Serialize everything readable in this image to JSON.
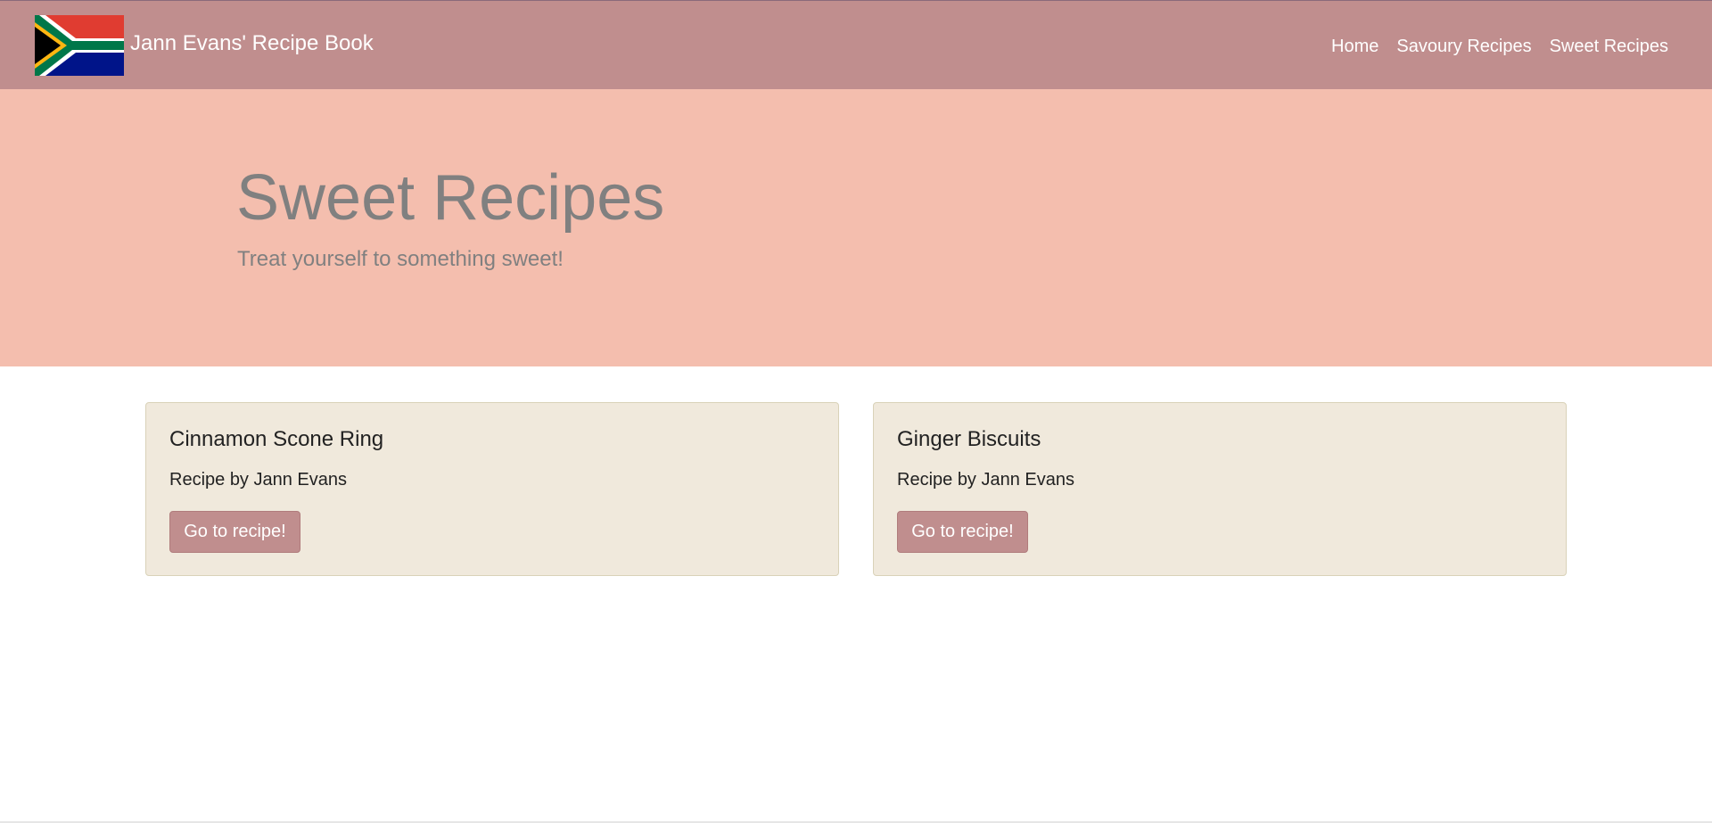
{
  "header": {
    "title": "Jann Evans' Recipe Book",
    "flag_icon": "south-africa-flag-icon",
    "nav": [
      {
        "label": "Home"
      },
      {
        "label": "Savoury Recipes"
      },
      {
        "label": "Sweet Recipes"
      }
    ]
  },
  "hero": {
    "title": "Sweet Recipes",
    "subtitle": "Treat yourself to something sweet!"
  },
  "recipes": [
    {
      "title": "Cinnamon Scone Ring",
      "author": "Recipe by Jann Evans",
      "button_label": "Go to recipe!"
    },
    {
      "title": "Ginger Biscuits",
      "author": "Recipe by Jann Evans",
      "button_label": "Go to recipe!"
    }
  ],
  "colors": {
    "navbar": "#c08e8e",
    "hero": "#f4beae",
    "card": "#f0e9dc",
    "button": "#c08e8e",
    "hero_text": "#808080"
  }
}
